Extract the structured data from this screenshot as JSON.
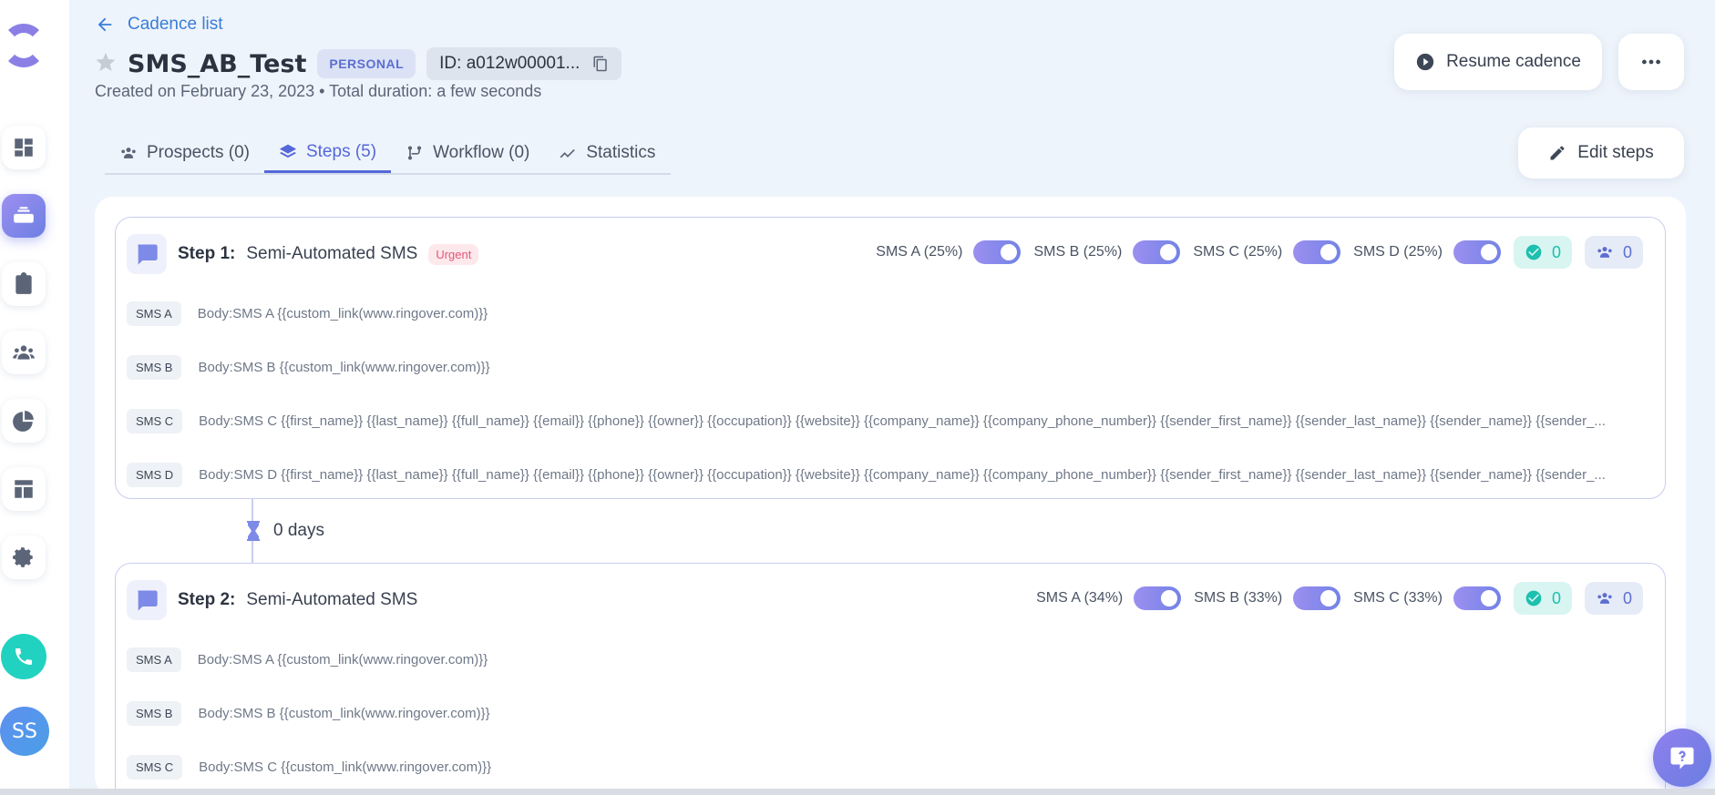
{
  "sidebar": {
    "avatar_initials": "SS"
  },
  "header": {
    "back_label": "Cadence list",
    "title": "SMS_AB_Test",
    "badge": "PERSONAL",
    "id_label": "ID: a012w00001...",
    "subtitle": "Created on February 23, 2023 • Total duration: a few seconds",
    "resume_label": "Resume cadence"
  },
  "tabs": [
    {
      "label": "Prospects (0)"
    },
    {
      "label": "Steps (5)"
    },
    {
      "label": "Workflow (0)"
    },
    {
      "label": "Statistics"
    }
  ],
  "edit_steps_label": "Edit steps",
  "steps": [
    {
      "label": "Step 1:",
      "type": "Semi-Automated SMS",
      "urgent": "Urgent",
      "variants": [
        "SMS A (25%)",
        "SMS B (25%)",
        "SMS C (25%)",
        "SMS D (25%)"
      ],
      "done_count": "0",
      "people_count": "0",
      "messages": [
        {
          "tag": "SMS A",
          "body": "Body:SMS A {{custom_link(www.ringover.com)}}"
        },
        {
          "tag": "SMS B",
          "body": "Body:SMS B {{custom_link(www.ringover.com)}}"
        },
        {
          "tag": "SMS C",
          "body": "Body:SMS C {{first_name}} {{last_name}} {{full_name}} {{email}} {{phone}} {{owner}} {{occupation}} {{website}} {{company_name}} {{company_phone_number}} {{sender_first_name}} {{sender_last_name}} {{sender_name}} {{sender_..."
        },
        {
          "tag": "SMS D",
          "body": "Body:SMS D {{first_name}} {{last_name}} {{full_name}} {{email}} {{phone}} {{owner}} {{occupation}} {{website}} {{company_name}} {{company_phone_number}} {{sender_first_name}} {{sender_last_name}} {{sender_name}} {{sender_..."
        }
      ]
    },
    {
      "label": "Step 2:",
      "type": "Semi-Automated SMS",
      "variants": [
        "SMS A (34%)",
        "SMS B (33%)",
        "SMS C (33%)"
      ],
      "done_count": "0",
      "people_count": "0",
      "messages": [
        {
          "tag": "SMS A",
          "body": "Body:SMS A {{custom_link(www.ringover.com)}}"
        },
        {
          "tag": "SMS B",
          "body": "Body:SMS B {{custom_link(www.ringover.com)}}"
        },
        {
          "tag": "SMS C",
          "body": "Body:SMS C {{custom_link(www.ringover.com)}}"
        }
      ]
    }
  ],
  "delay_label": "0 days",
  "colors": {
    "accent": "#5468d8",
    "teal": "#22d2c0",
    "urgent": "#e25877"
  }
}
